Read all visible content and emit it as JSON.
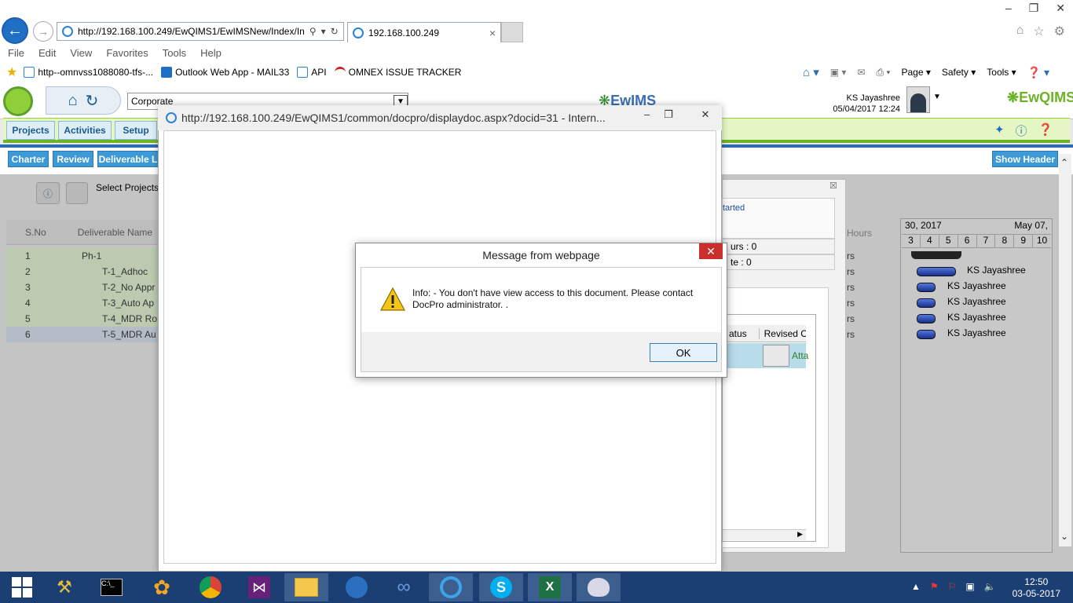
{
  "browser": {
    "address": "http://192.168.100.249/EwQIMS1/EwIMSNew/Index/In",
    "tab_title": "192.168.100.249",
    "menu": [
      "File",
      "Edit",
      "View",
      "Favorites",
      "Tools",
      "Help"
    ],
    "favorites": [
      "http--omnvss1088080-tfs-...",
      "Outlook Web App - MAIL33",
      "API",
      "OMNEX ISSUE TRACKER"
    ],
    "commands": [
      "Page",
      "Safety",
      "Tools"
    ]
  },
  "app": {
    "company_select": "Corporate",
    "logo_text": "EwIMS",
    "brand_text": "EwQIMS",
    "user_name": "KS Jayashree",
    "user_datetime": "05/04/2017 12:24",
    "nav": [
      "Projects",
      "Activities",
      "Setup"
    ],
    "subnav": [
      "Charter",
      "Review",
      "Deliverable L"
    ],
    "show_header": "Show Header",
    "select_projects": "Select Projects",
    "grid_headers": {
      "sno": "S.No",
      "name": "Deliverable Name",
      "hours": "Hours"
    },
    "rows": [
      {
        "sno": "1",
        "name": "Ph-1"
      },
      {
        "sno": "2",
        "name": "T-1_Adhoc"
      },
      {
        "sno": "3",
        "name": "T-2_No Appr"
      },
      {
        "sno": "4",
        "name": "T-3_Auto Ap"
      },
      {
        "sno": "5",
        "name": "T-4_MDR Ro"
      },
      {
        "sno": "6",
        "name": "T-5_MDR Au"
      }
    ],
    "hrs_cells": [
      "rs",
      "rs",
      "rs",
      "rs",
      "rs",
      "rs"
    ],
    "right_panel": {
      "status": "tarted",
      "hours_label": "urs : 0",
      "te_label": "te : 0",
      "col_status": "atus",
      "col_revised": "Revised C",
      "attach": "Atta"
    },
    "gantt": {
      "date_left": "30, 2017",
      "date_right": "May 07,",
      "days": [
        "3",
        "4",
        "5",
        "6",
        "7",
        "8",
        "9",
        "10"
      ],
      "assignees": [
        "KS Jayashree",
        "KS Jayashree",
        "KS Jayashree",
        "KS Jayashree",
        "KS Jayashree"
      ]
    }
  },
  "popup": {
    "title": "http://192.168.100.249/EwQIMS1/common/docpro/displaydoc.aspx?docid=31 - Intern..."
  },
  "dialog": {
    "title": "Message from webpage",
    "message": "Info: - You don't have view access to this document. Please contact DocPro administrator. .",
    "ok": "OK"
  },
  "taskbar": {
    "time": "12:50",
    "date": "03-05-2017"
  },
  "colors": {
    "accent_blue": "#3d9ad6",
    "nav_green": "#e4f7c2",
    "taskbar": "#1b3f73",
    "close_red": "#c9302c"
  }
}
